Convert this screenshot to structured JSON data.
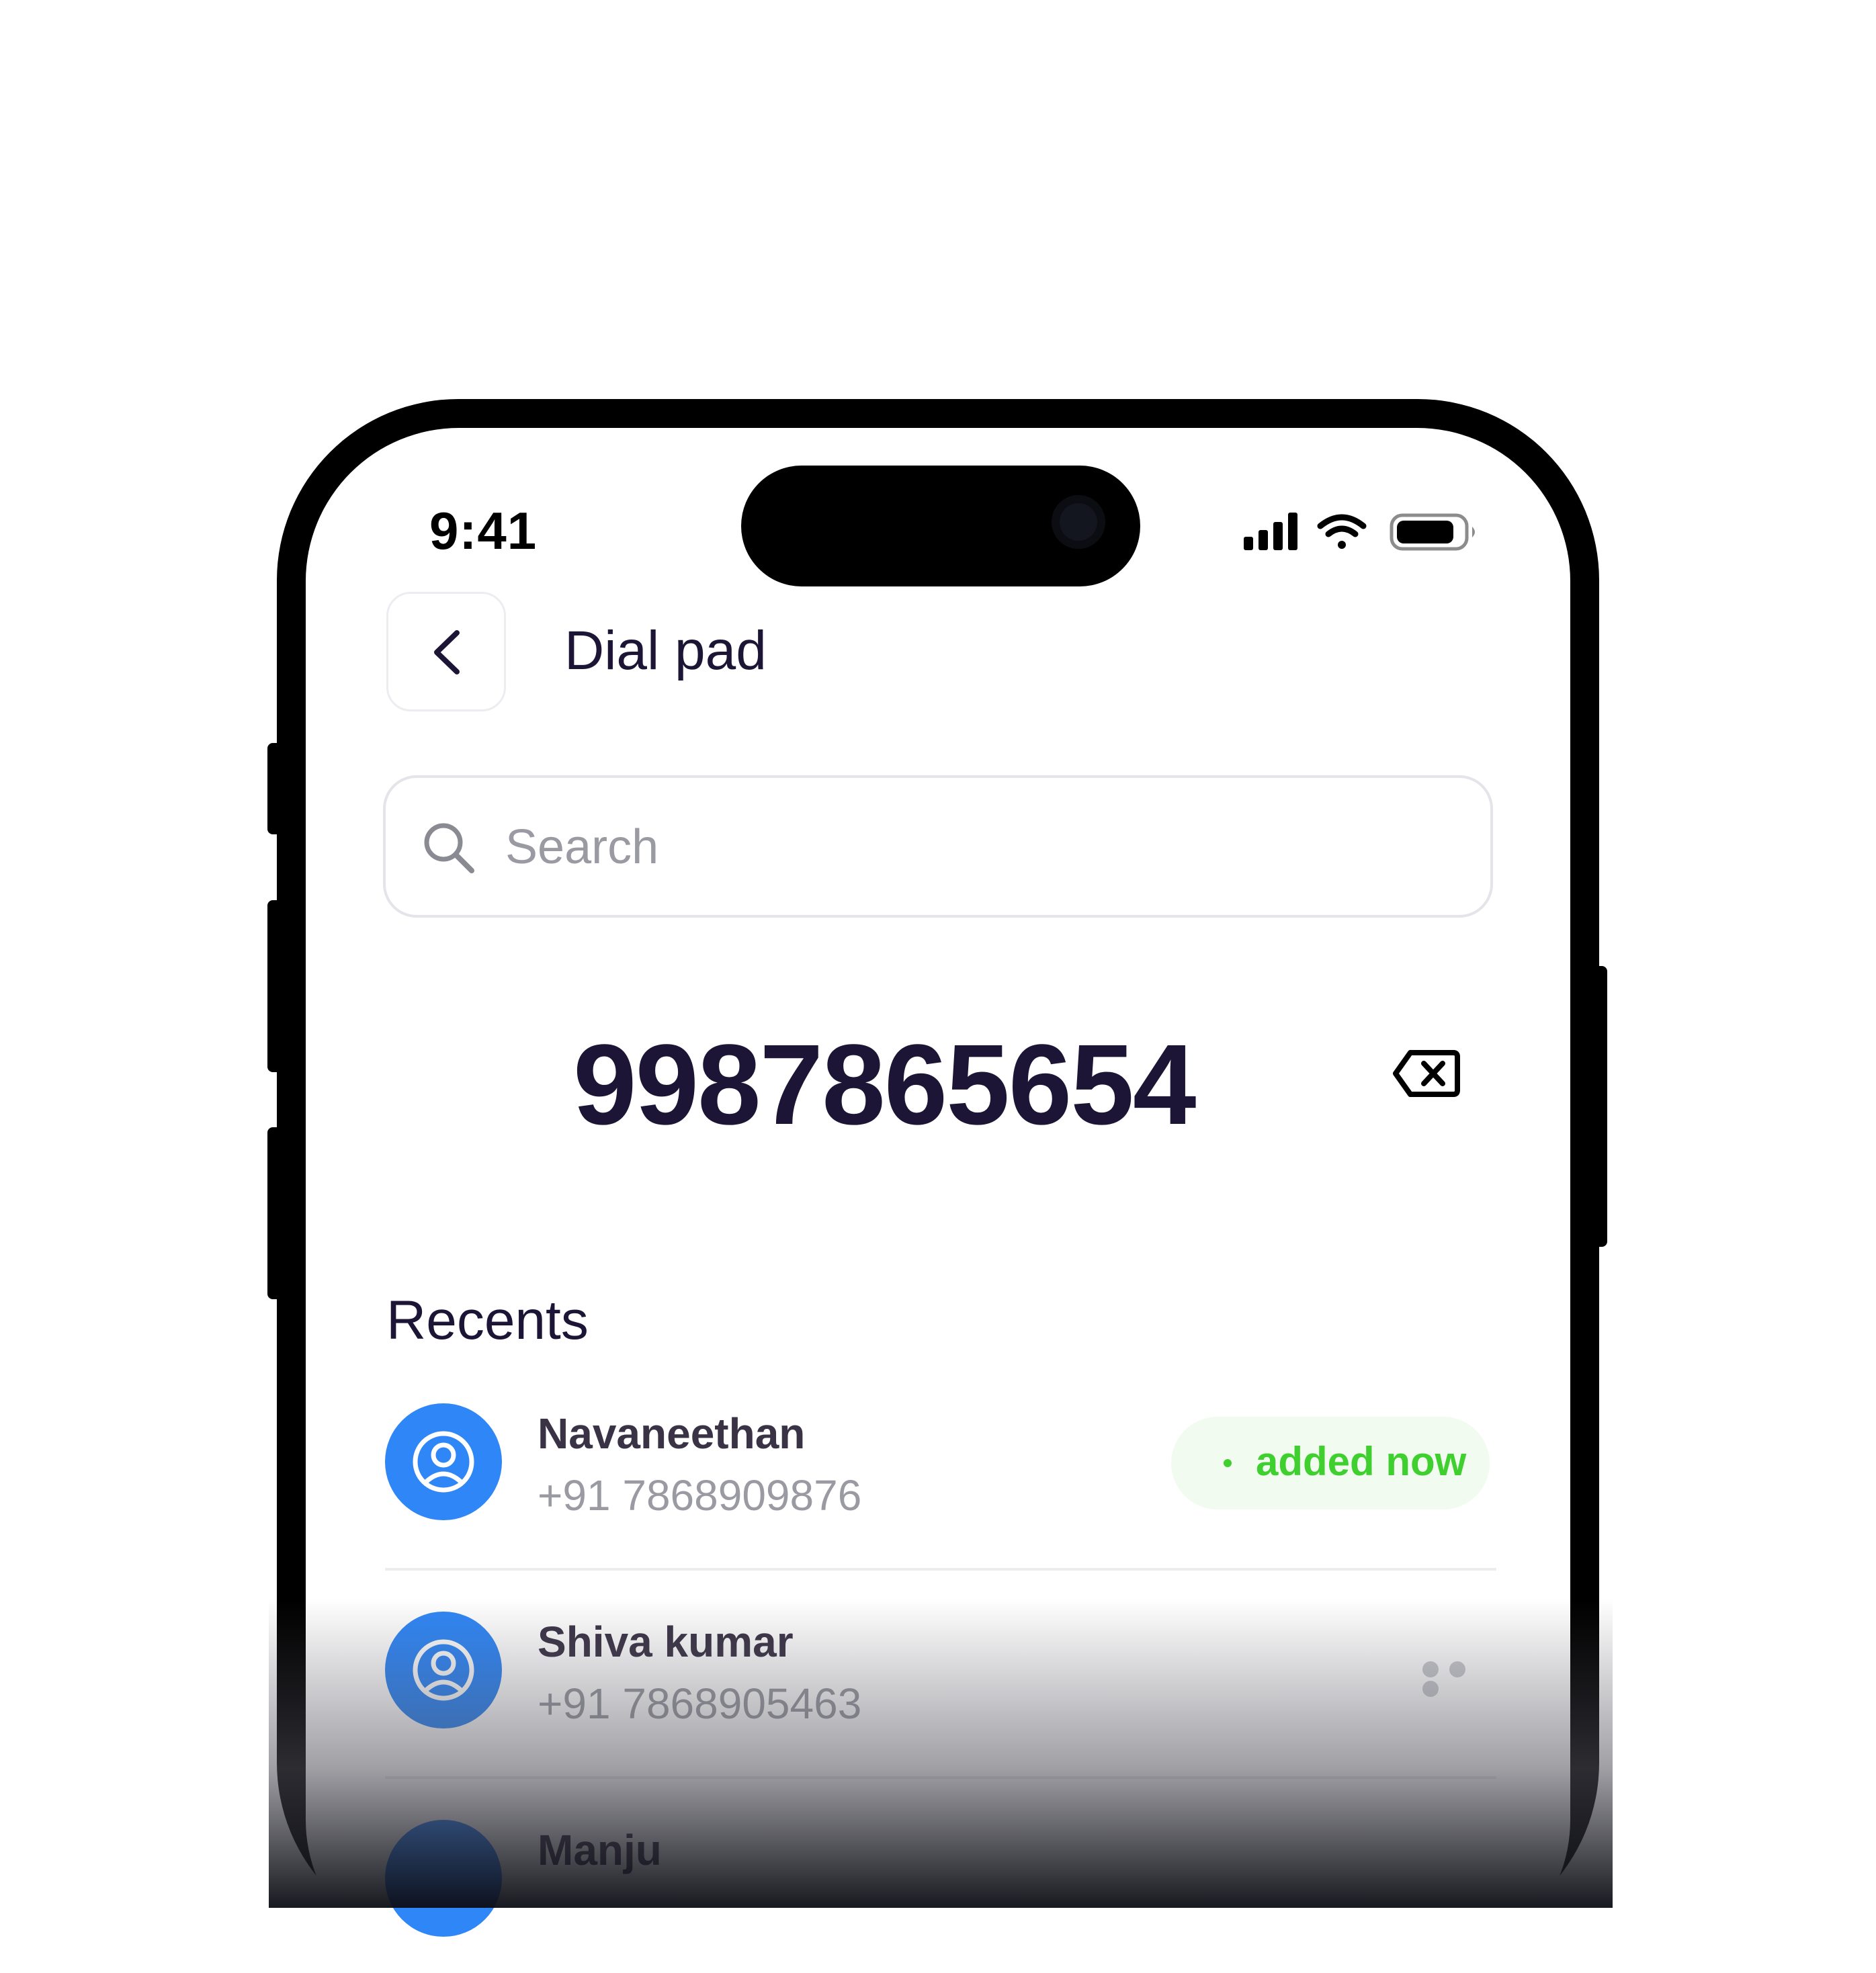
{
  "status_bar": {
    "time": "9:41"
  },
  "header": {
    "title": "Dial pad"
  },
  "search": {
    "placeholder": "Search",
    "value": ""
  },
  "dial": {
    "number": "9987865654"
  },
  "recents": {
    "title": "Recents",
    "items": [
      {
        "name": "Navaneethan",
        "phone": "+91 7868909876",
        "badge": "added now"
      },
      {
        "name": "Shiva kumar",
        "phone": "+91 7868905463"
      },
      {
        "name": "Manju"
      }
    ]
  },
  "colors": {
    "accent": "#2f86f6",
    "title_text": "#1d1535",
    "badge_green": "#3fcf2e",
    "badge_bg": "#f1fbf0",
    "muted_text": "#9a9aa2"
  },
  "icons": [
    "back-chevron-icon",
    "search-icon",
    "backspace-icon",
    "user-icon",
    "more-icon",
    "signal-icon",
    "wifi-icon",
    "battery-icon"
  ]
}
